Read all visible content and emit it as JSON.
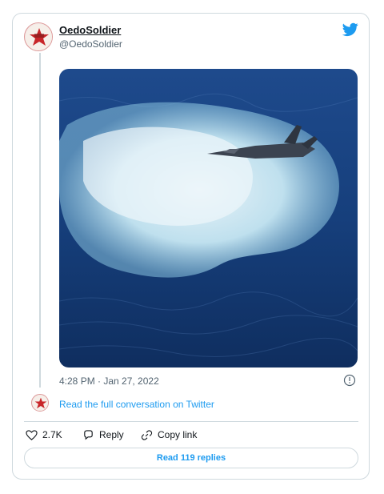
{
  "tweet": {
    "author": {
      "name": "OedoSoldier",
      "handle": "@OedoSoldier"
    },
    "timestamp": "4:28 PM · Jan 27, 2022",
    "read_conversation": "Read the full conversation on Twitter",
    "actions": {
      "likes": "2.7K",
      "reply": "Reply",
      "copy_link": "Copy link"
    },
    "read_replies": "Read 119 replies"
  },
  "colors": {
    "accent": "#1d9bf0",
    "border": "#cfd9de",
    "ocean": "#153b78",
    "foam": "#cfe6f2"
  },
  "icons": {
    "brand": "twitter-bird-icon",
    "info": "info-icon",
    "like": "heart-icon",
    "reply": "reply-icon",
    "copy": "link-icon"
  }
}
